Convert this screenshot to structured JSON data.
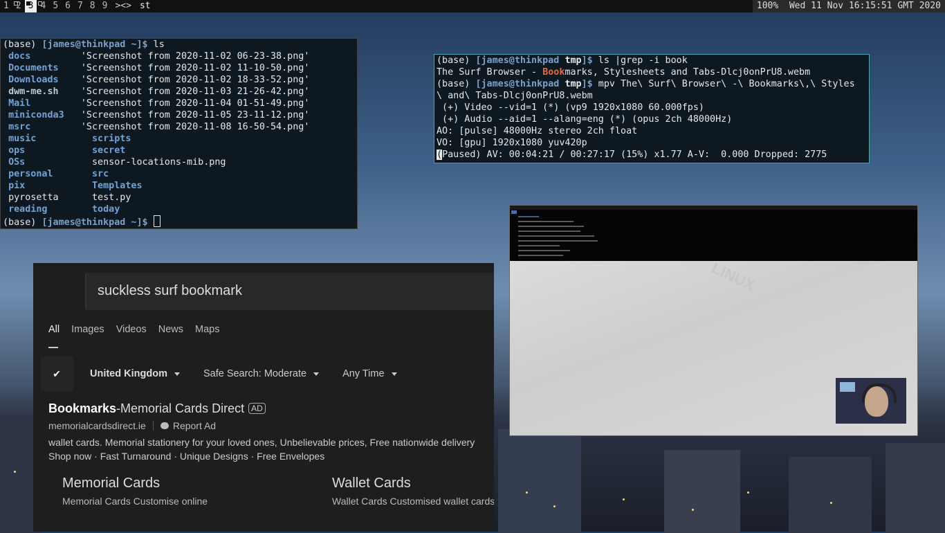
{
  "topbar": {
    "tags": [
      {
        "label": "1",
        "occupied": false,
        "selected": false
      },
      {
        "label": "2",
        "occupied": true,
        "selected": false
      },
      {
        "label": "3",
        "occupied": true,
        "selected": true
      },
      {
        "label": "4",
        "occupied": true,
        "selected": false
      },
      {
        "label": "5",
        "occupied": false,
        "selected": false
      },
      {
        "label": "6",
        "occupied": false,
        "selected": false
      },
      {
        "label": "7",
        "occupied": false,
        "selected": false
      },
      {
        "label": "8",
        "occupied": false,
        "selected": false
      },
      {
        "label": "9",
        "occupied": false,
        "selected": false
      }
    ],
    "layout_symbol": "><>",
    "window_title": "st",
    "status": "100%  Wed 11 Nov 16:15:51 GMT 2020"
  },
  "terminal1": {
    "prompt_base": "(base) ",
    "prompt_user": "[james@thinkpad ~]$",
    "command": " ls",
    "rows": [
      {
        "a": "docs",
        "b": "'Screenshot from 2020-11-02 06-23-38.png'"
      },
      {
        "a": "Documents",
        "b": "'Screenshot from 2020-11-02 11-10-50.png'"
      },
      {
        "a": "Downloads",
        "b": "'Screenshot from 2020-11-02 18-33-52.png'"
      },
      {
        "a": "dwm-me.sh",
        "b": "'Screenshot from 2020-11-03 21-26-42.png'"
      },
      {
        "a": "Mail",
        "b": "'Screenshot from 2020-11-04 01-51-49.png'"
      },
      {
        "a": "miniconda3",
        "b": "'Screenshot from 2020-11-05 23-11-12.png'"
      },
      {
        "a": "msrc",
        "b": "'Screenshot from 2020-11-08 16-50-54.png'"
      },
      {
        "a": "music",
        "b": "scripts"
      },
      {
        "a": "ops",
        "b": "secret"
      },
      {
        "a": "OSs",
        "b": "sensor-locations-mib.png"
      },
      {
        "a": "personal",
        "b": "src"
      },
      {
        "a": "pix",
        "b": "Templates"
      },
      {
        "a": "pyrosetta",
        "b": "test.py"
      },
      {
        "a": "reading",
        "b": "today"
      }
    ],
    "final_prompt_user": "[james@thinkpad ~]$"
  },
  "terminal2": {
    "prompt_base": "(base) ",
    "prompt_user_a": "[james@thinkpad ",
    "prompt_dir": "tmp",
    "prompt_user_b": "]$",
    "cmd1": " ls |grep -i book",
    "out1_a": "The Surf Browser - ",
    "out1_hl": "Book",
    "out1_b": "marks, Stylesheets and Tabs-Dlcj0onPrU8.webm",
    "cmd2": " mpv The\\ Surf\\ Browser\\ -\\ Bookmarks\\,\\ Styles",
    "cmd2_cont": "\\ and\\ Tabs-Dlcj0onPrU8.webm",
    "line_video": " (+) Video --vid=1 (*) (vp9 1920x1080 60.000fps)",
    "line_audio": " (+) Audio --aid=1 --alang=eng (*) (opus 2ch 48000Hz)",
    "line_ao": "AO: [pulse] 48000Hz stereo 2ch float",
    "line_vo": "VO: [gpu] 1920x1080 yuv420p",
    "status_first": "(",
    "status_rest": "Paused) AV: 00:04:21 / 00:27:17 (15%) x1.77 A-V:  0.000 Dropped: 2775"
  },
  "browser": {
    "search_value": "suckless surf bookmark",
    "tabs": [
      "All",
      "Images",
      "Videos",
      "News",
      "Maps"
    ],
    "region": "United Kingdom",
    "safe_search": "Safe Search: Moderate",
    "time": "Any Time",
    "ad_title_bold": "Bookmarks",
    "ad_title_rest": "-Memorial Cards Direct",
    "ad_badge": "AD",
    "ad_url": "memorialcardsdirect.ie",
    "report_ad": "Report Ad",
    "ad_desc_1": "wallet cards. Memorial stationery for your loved ones, Unbelievable prices, Free nationwide delivery",
    "ad_desc_2": "Shop now · Fast Turnaround · Unique Designs · Free Envelopes",
    "sitelinks": [
      {
        "title": "Memorial Cards",
        "sub": "Memorial Cards Customise online"
      },
      {
        "title": "Wallet Cards",
        "sub": "Wallet Cards Customised wallet cards"
      }
    ]
  },
  "video": {
    "logo_text": "LINUX"
  }
}
